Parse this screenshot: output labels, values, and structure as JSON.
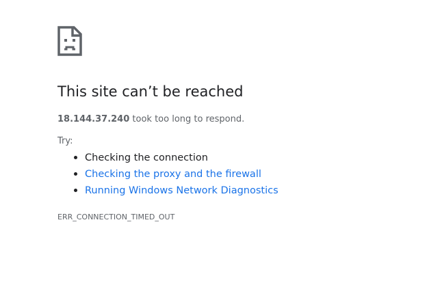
{
  "error": {
    "icon": "sad-page-icon",
    "title": "This site can’t be reached",
    "host": "18.144.37.240",
    "summary_suffix": " took too long to respond.",
    "try_label": "Try:",
    "suggestions": [
      {
        "label": "Checking the connection",
        "is_link": false
      },
      {
        "label": "Checking the proxy and the firewall",
        "is_link": true
      },
      {
        "label": "Running Windows Network Diagnostics",
        "is_link": true
      }
    ],
    "code": "ERR_CONNECTION_TIMED_OUT"
  },
  "colors": {
    "title": "#202124",
    "body_text": "#5f6368",
    "link": "#1a73e8",
    "background": "#ffffff"
  }
}
